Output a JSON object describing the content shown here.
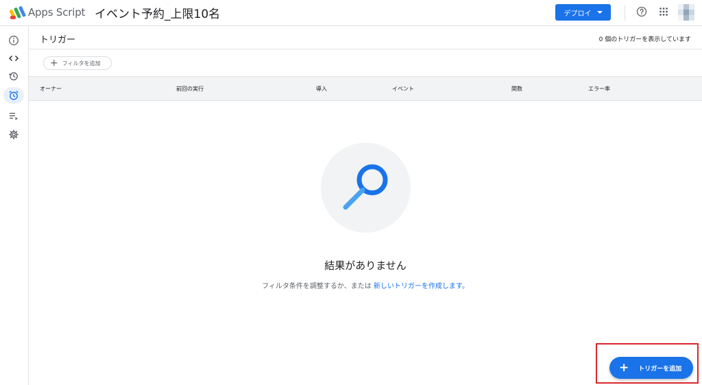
{
  "header": {
    "app_name": "Apps Script",
    "project_title": "イベント予約_上限10名",
    "deploy_label": "デプロイ",
    "help_icon": "help-circle-icon",
    "apps_icon": "apps-grid-icon",
    "avatar_colors": [
      "#eef2f6",
      "#b9c6d3",
      "#e8eef4",
      "#d9e3ec",
      "#8fa5ba",
      "#c9d5e0",
      "#f2f5f8",
      "#a7b8c9",
      "#dbe4ec"
    ]
  },
  "colors": {
    "accent": "#1a73e8",
    "active_rail_bg": "#e8f0fe",
    "highlight": "#d9262c"
  },
  "sidebar": {
    "items": [
      {
        "icon": "info-icon",
        "active": false
      },
      {
        "icon": "code-icon",
        "active": false
      },
      {
        "icon": "history-icon",
        "active": false
      },
      {
        "icon": "alarm-clock-icon",
        "active": true
      },
      {
        "icon": "executions-icon",
        "active": false
      },
      {
        "icon": "gear-icon",
        "active": false
      }
    ]
  },
  "main": {
    "title": "トリガー",
    "trigger_count": "0 個のトリガーを表示しています",
    "filter_label": "フィルタを追加",
    "columns": [
      "オーナー",
      "前回の実行",
      "導入",
      "イベント",
      "関数",
      "エラー率"
    ]
  },
  "empty_state": {
    "icon": "search-icon",
    "title": "結果がありません",
    "description_prefix": "フィルタ条件を調整するか、または ",
    "description_link": "新しいトリガーを作成します。"
  },
  "fab": {
    "label": "トリガーを追加"
  }
}
